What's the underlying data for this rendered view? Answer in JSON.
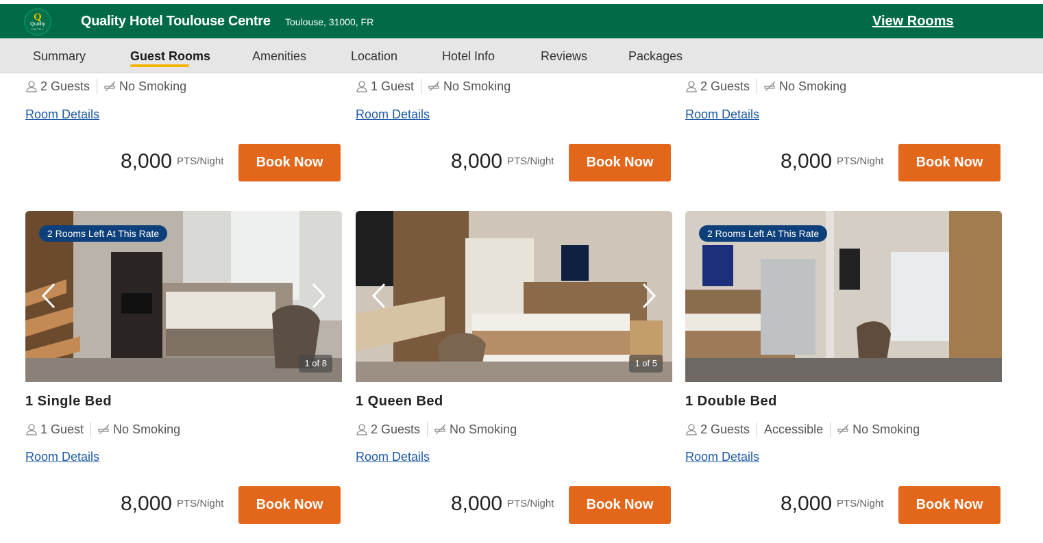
{
  "header": {
    "logo": {
      "q": "Q",
      "word": "Quality",
      "sub": "HOTEL"
    },
    "hotel_name": "Quality Hotel Toulouse Centre",
    "location": "Toulouse, 31000, FR",
    "view_rooms": "View Rooms",
    "brand_color": "#006b46"
  },
  "tabs": [
    {
      "label": "Summary"
    },
    {
      "label": "Guest Rooms",
      "active": true
    },
    {
      "label": "Amenities"
    },
    {
      "label": "Location"
    },
    {
      "label": "Hotel Info"
    },
    {
      "label": "Reviews"
    },
    {
      "label": "Packages"
    }
  ],
  "top_row": [
    {
      "guests": "2 Guests",
      "smoking": "No Smoking",
      "details": "Room Details",
      "price": "8,000",
      "unit": "PTS/Night",
      "book": "Book Now"
    },
    {
      "guests": "1 Guest",
      "smoking": "No Smoking",
      "details": "Room Details",
      "price": "8,000",
      "unit": "PTS/Night",
      "book": "Book Now"
    },
    {
      "guests": "2 Guests",
      "smoking": "No Smoking",
      "details": "Room Details",
      "price": "8,000",
      "unit": "PTS/Night",
      "book": "Book Now"
    }
  ],
  "rooms": [
    {
      "badge": "2 Rooms Left At This Rate",
      "counter": "1 of 8",
      "title": "1 Single Bed",
      "guests": "1 Guest",
      "smoking": "No Smoking",
      "details": "Room Details",
      "price": "8,000",
      "unit": "PTS/Night",
      "book": "Book Now"
    },
    {
      "counter": "1 of 5",
      "title": "1 Queen Bed",
      "guests": "2 Guests",
      "smoking": "No Smoking",
      "details": "Room Details",
      "price": "8,000",
      "unit": "PTS/Night",
      "book": "Book Now"
    },
    {
      "badge": "2 Rooms Left At This Rate",
      "title": "1 Double Bed",
      "guests": "2 Guests",
      "accessible": "Accessible",
      "smoking": "No Smoking",
      "details": "Room Details",
      "price": "8,000",
      "unit": "PTS/Night",
      "book": "Book Now"
    }
  ],
  "colors": {
    "accent": "#e3671b",
    "badge": "#0d3f7a",
    "tab_underline": "#f5b400",
    "link": "#1f5aa6"
  },
  "icons": {
    "guest": "person-icon",
    "smoking": "no-smoking-icon",
    "prev": "chevron-left-icon",
    "next": "chevron-right-icon"
  }
}
